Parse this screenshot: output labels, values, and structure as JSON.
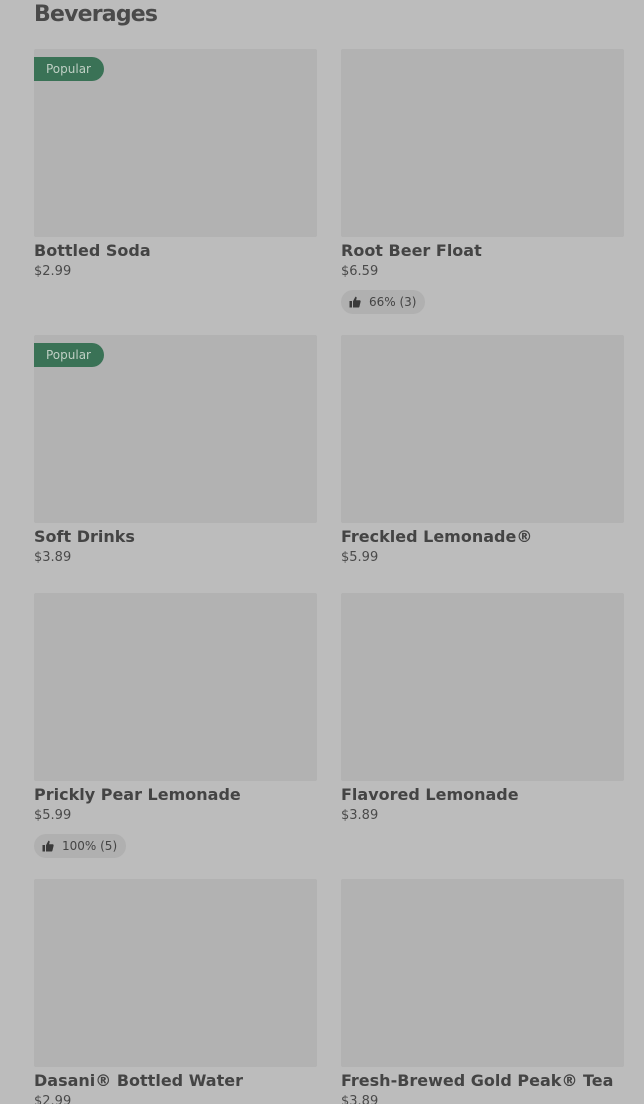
{
  "section": {
    "title": "Beverages"
  },
  "items": [
    {
      "name": "Bottled Soda",
      "price": "$2.99",
      "badge": "Popular",
      "rating": ""
    },
    {
      "name": "Root Beer Float",
      "price": "$6.59",
      "badge": "",
      "rating": "66% (3)"
    },
    {
      "name": "Soft Drinks",
      "price": "$3.89",
      "badge": "Popular",
      "rating": ""
    },
    {
      "name": "Freckled Lemonade®",
      "price": "$5.99",
      "badge": "",
      "rating": ""
    },
    {
      "name": "Prickly Pear Lemonade",
      "price": "$5.99",
      "badge": "",
      "rating": "100% (5)"
    },
    {
      "name": "Flavored Lemonade",
      "price": "$3.89",
      "badge": "",
      "rating": ""
    },
    {
      "name": "Dasani® Bottled Water",
      "price": "$2.99",
      "badge": "",
      "rating": ""
    },
    {
      "name": "Fresh-Brewed Gold Peak® Tea",
      "price": "$3.89",
      "badge": "",
      "rating": ""
    }
  ],
  "icons": {
    "rating": "thumbs-up-icon"
  },
  "colors": {
    "badge_background": "#3a7256",
    "thumbnail_placeholder": "#b2b2b2",
    "page_background": "#bcbcbc"
  }
}
